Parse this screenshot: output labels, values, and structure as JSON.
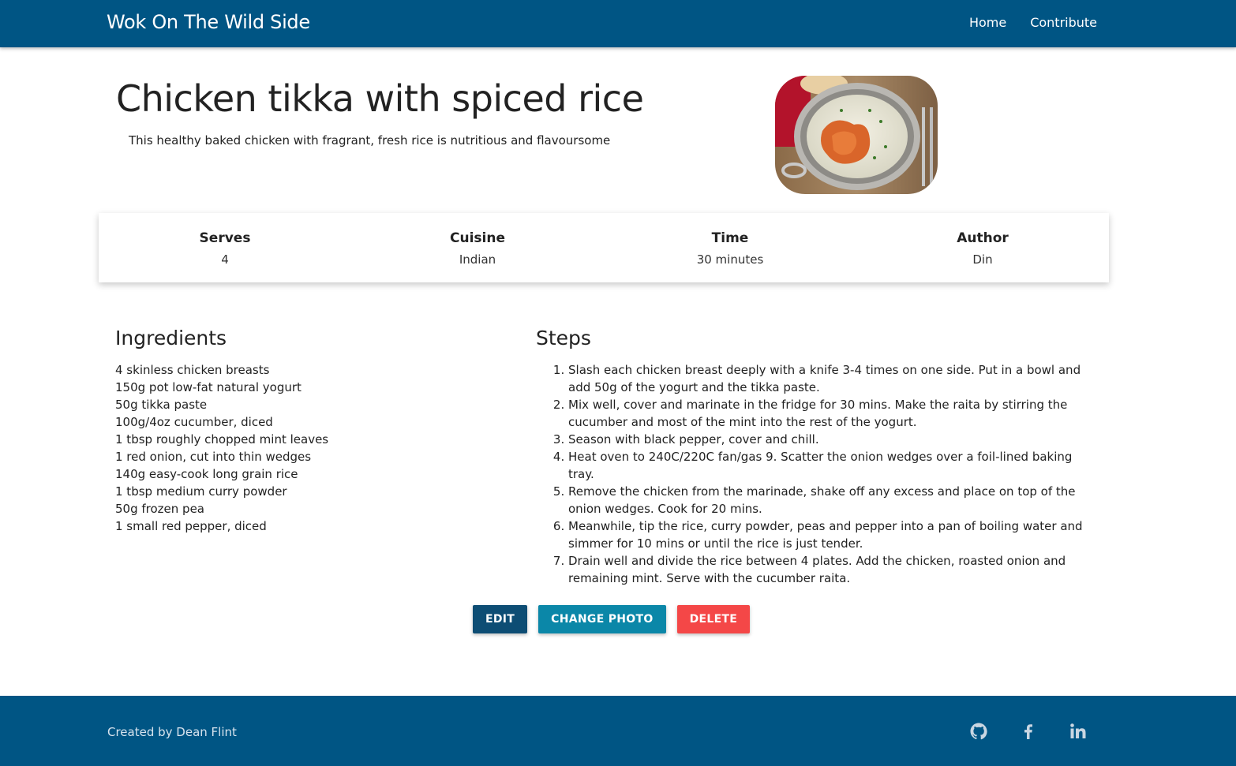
{
  "navbar": {
    "brand": "Wok On The Wild Side",
    "links": [
      "Home",
      "Contribute"
    ]
  },
  "recipe": {
    "title": "Chicken tikka with spiced rice",
    "description": "This healthy baked chicken with fragrant, fresh rice is nutritious and flavoursome",
    "info": [
      {
        "label": "Serves",
        "value": "4"
      },
      {
        "label": "Cuisine",
        "value": "Indian"
      },
      {
        "label": "Time",
        "value": "30 minutes"
      },
      {
        "label": "Author",
        "value": "Din"
      }
    ],
    "ingredients_title": "Ingredients",
    "ingredients": [
      "4 skinless chicken breasts",
      "150g pot low-fat natural yogurt",
      "50g tikka paste",
      "100g/4oz cucumber, diced",
      "1 tbsp roughly chopped mint leaves",
      "1 red onion, cut into thin wedges",
      "140g easy-cook long grain rice",
      "1 tbsp medium curry powder",
      "50g frozen pea",
      "1 small red pepper, diced"
    ],
    "steps_title": "Steps",
    "steps": [
      "Slash each chicken breast deeply with a knife 3-4 times on one side. Put in a bowl and add 50g of the yogurt and the tikka paste.",
      "Mix well, cover and marinate in the fridge for 30 mins. Make the raita by stirring the cucumber and most of the mint into the rest of the yogurt.",
      "Season with black pepper, cover and chill.",
      "Heat oven to 240C/220C fan/gas 9. Scatter the onion wedges over a foil-lined baking tray.",
      "Remove the chicken from the marinade, shake off any excess and place on top of the onion wedges. Cook for 20 mins.",
      "Meanwhile, tip the rice, curry powder, peas and pepper into a pan of boiling water and simmer for 10 mins or until the rice is just tender.",
      "Drain well and divide the rice between 4 plates. Add the chicken, roasted onion and remaining mint. Serve with the cucumber raita."
    ]
  },
  "actions": {
    "edit": "EDIT",
    "change_photo": "CHANGE PHOTO",
    "delete": "DELETE"
  },
  "footer": {
    "credit": "Created by Dean Flint",
    "social_icons": [
      "github-icon",
      "facebook-icon",
      "linkedin-icon"
    ]
  },
  "colors": {
    "primary": "#005584",
    "edit_button": "#0d4d74",
    "photo_button": "#0b87a8",
    "delete_button": "#f44747"
  }
}
